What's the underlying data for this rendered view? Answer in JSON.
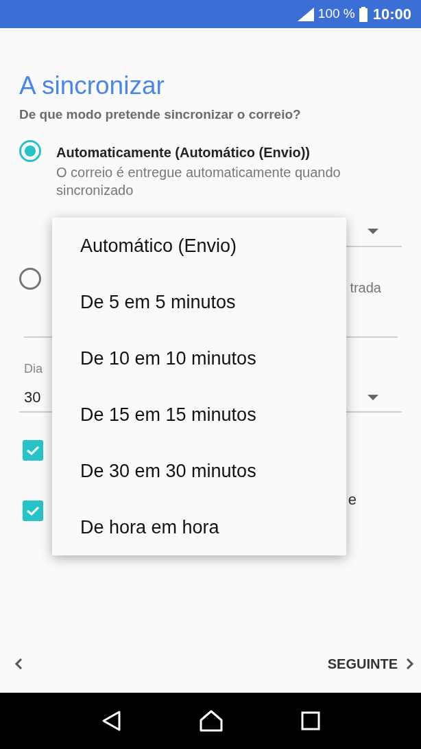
{
  "status_bar": {
    "battery": "100 %",
    "time": "10:00"
  },
  "title": "A sincronizar",
  "subtitle": "De que modo pretende sincronizar o correio?",
  "sync_options": [
    {
      "label": "Automaticamente (Automático (Envio))",
      "description": "O correio é entregue automaticamente quando sincronizado",
      "selected": true
    },
    {
      "description": "trada",
      "selected": false
    }
  ],
  "days_field": {
    "label": "Dia",
    "value": "30"
  },
  "checkboxes": [
    {
      "checked": true
    },
    {
      "label": "e",
      "checked": true
    }
  ],
  "menu": {
    "items": [
      "Automático (Envio)",
      "De 5 em 5 minutos",
      "De 10 em 10 minutos",
      "De 15 em 15 minutos",
      "De 30 em 30 minutos",
      "De hora em hora"
    ]
  },
  "footer": {
    "next": "SEGUINTE"
  }
}
